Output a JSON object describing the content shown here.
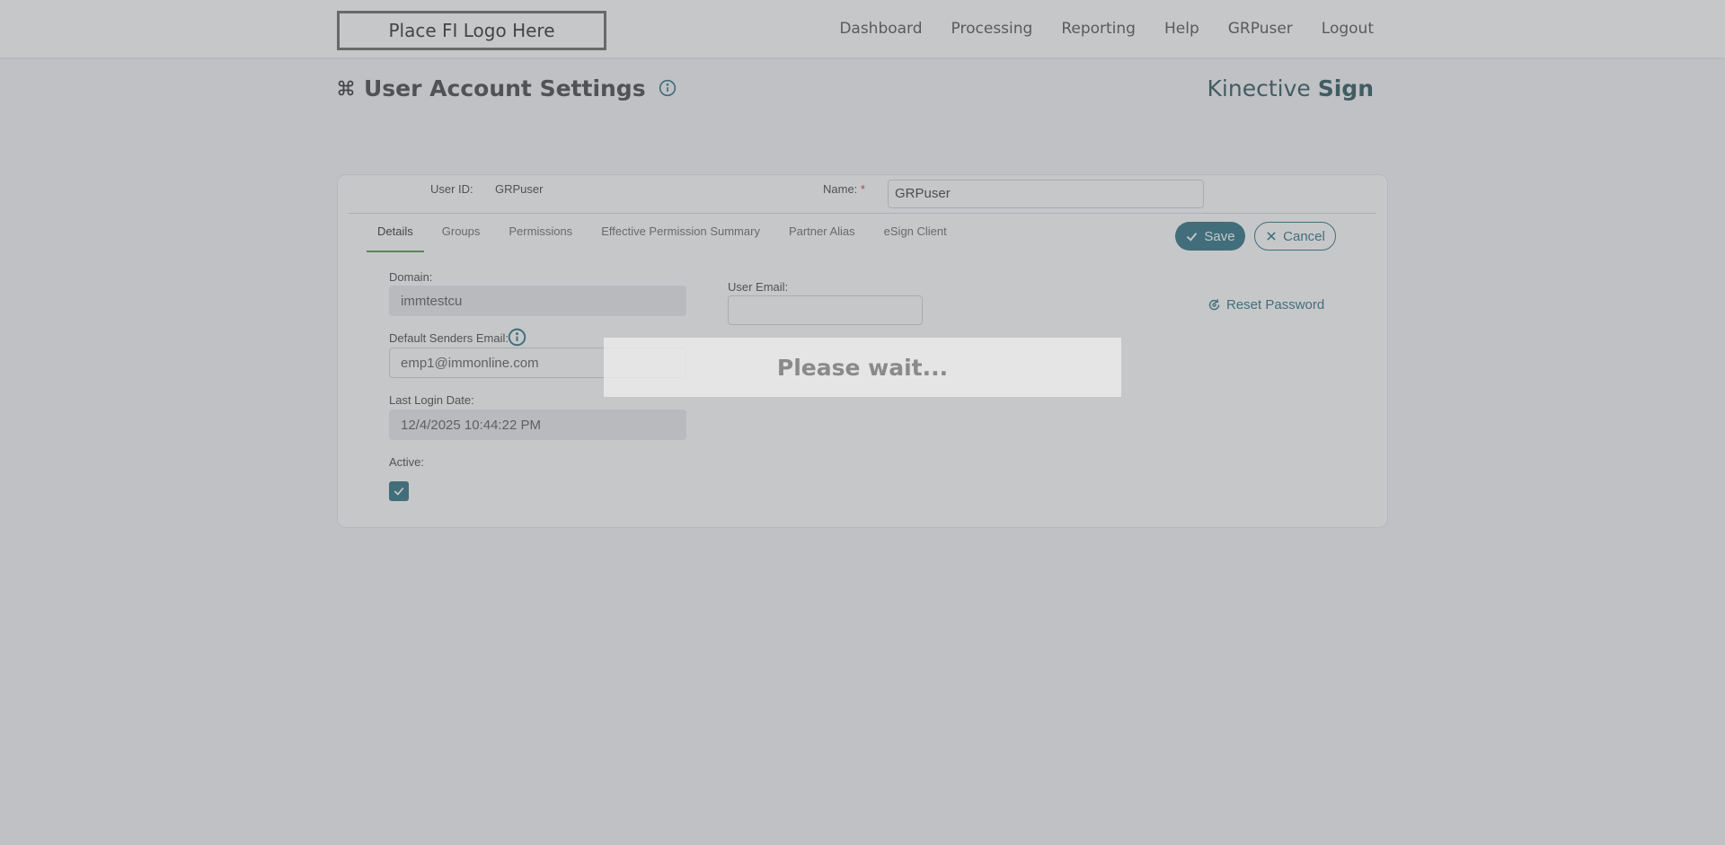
{
  "header": {
    "logo_text": "Place FI Logo Here",
    "nav": [
      "Dashboard",
      "Processing",
      "Reporting",
      "Help",
      "GRPuser",
      "Logout"
    ]
  },
  "page": {
    "title": "User Account Settings",
    "brand_light": "Kinective ",
    "brand_bold": "Sign"
  },
  "user": {
    "user_id_label": "User ID:",
    "user_id_value": "GRPuser",
    "name_label": "Name:",
    "required_marker": "*",
    "name_value": "GRPuser"
  },
  "tabs": [
    "Details",
    "Groups",
    "Permissions",
    "Effective Permission Summary",
    "Partner Alias",
    "eSign Client"
  ],
  "actions": {
    "save_label": "Save",
    "cancel_label": "Cancel",
    "reset_password_label": "Reset Password"
  },
  "details": {
    "domain_label": "Domain:",
    "domain_value": "immtestcu",
    "user_email_label": "User Email:",
    "user_email_value": "",
    "default_senders_email_label": "Default Senders Email:",
    "default_senders_email_value": "emp1@immonline.com",
    "last_login_label": "Last Login Date:",
    "last_login_value": "12/4/2025 10:44:22 PM",
    "active_label": "Active:",
    "active_checked": true
  },
  "overlay": {
    "message": "Please wait..."
  },
  "colors": {
    "brand_teal": "#0e5e6f",
    "active_tab_underline": "#3a8a2f",
    "required": "#dd1111"
  }
}
